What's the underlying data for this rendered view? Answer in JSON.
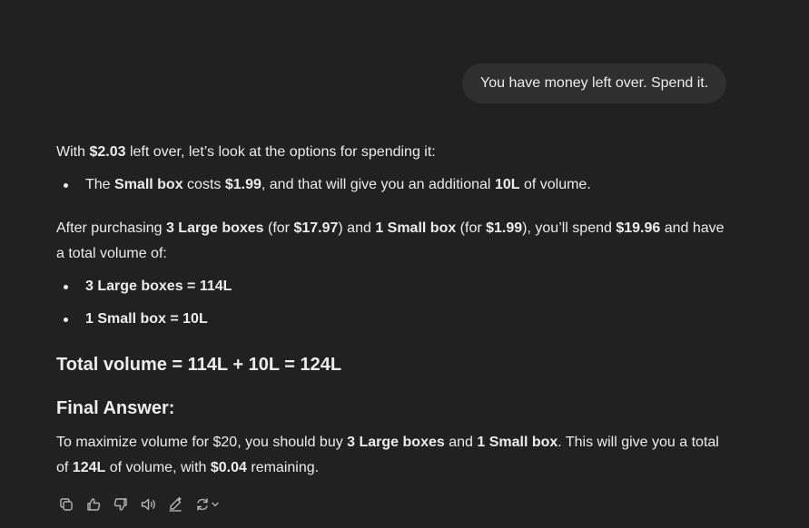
{
  "user_message": "You have money left over. Spend it.",
  "answer": {
    "intro": {
      "t1": "With ",
      "b1": "$2.03",
      "t2": " left over, let’s look at the options for spending it:"
    },
    "option": {
      "t1": "The ",
      "b1": "Small box",
      "t2": " costs ",
      "b2": "$1.99",
      "t3": ", and that will give you an additional ",
      "b3": "10L",
      "t4": " of volume."
    },
    "summary": {
      "t1": "After purchasing ",
      "b1": "3 Large boxes",
      "t2": " (for ",
      "b2": "$17.97",
      "t3": ") and ",
      "b3": "1 Small box",
      "t4": " (for ",
      "b4": "$1.99",
      "t5": "), you’ll spend ",
      "b5": "$19.96",
      "t6": " and have a total volume of:"
    },
    "volumes": [
      {
        "b": "3 Large boxes",
        "t": " = 114L"
      },
      {
        "b": "1 Small box",
        "t": " = 10L"
      }
    ],
    "total_heading": "Total volume = 114L + 10L = 124L",
    "final_heading": "Final Answer:",
    "final": {
      "t1": "To maximize volume for $20, you should buy ",
      "b1": "3 Large boxes",
      "t2": " and ",
      "b2": "1 Small box",
      "t3": ". This will give you a total of ",
      "b3": "124L",
      "t4": " of volume, with ",
      "b4": "$0.04",
      "t5": " remaining."
    }
  },
  "actions": [
    {
      "icon": "copy-icon"
    },
    {
      "icon": "thumbs-up-icon"
    },
    {
      "icon": "thumbs-down-icon"
    },
    {
      "icon": "read-aloud-icon"
    },
    {
      "icon": "edit-icon"
    },
    {
      "icon": "regenerate-icon"
    }
  ],
  "colors": {
    "background": "#212121",
    "bubble": "#2f2f2f",
    "text": "#ececec",
    "icon": "#b4b4b4"
  }
}
